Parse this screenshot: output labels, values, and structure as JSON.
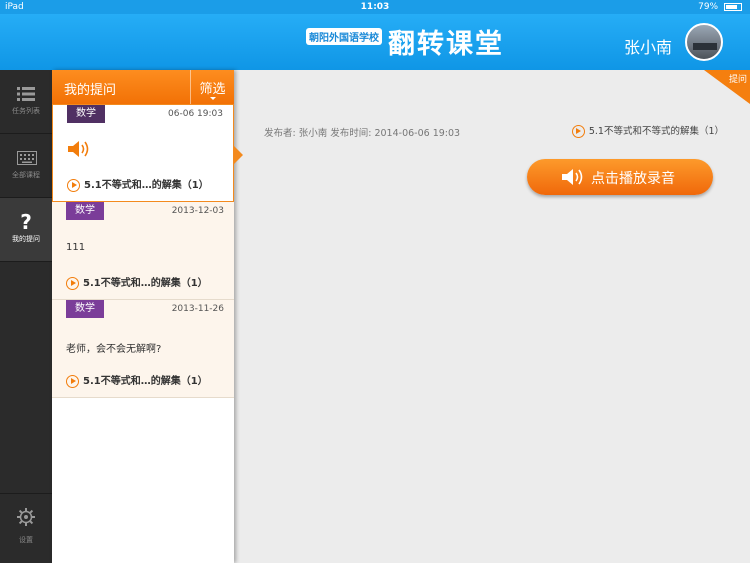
{
  "status": {
    "device": "iPad",
    "time": "11:03",
    "battery": "79%",
    "battery_level": 0.79
  },
  "header": {
    "school": "朝阳外国语学校",
    "app_title": "翻转课堂",
    "user_name": "张小南"
  },
  "nav": {
    "items": [
      {
        "label": "任务列表",
        "icon": "list-icon"
      },
      {
        "label": "全部课程",
        "icon": "keyboard-icon"
      },
      {
        "label": "我的提问",
        "icon": "question-icon"
      }
    ],
    "settings": "设置"
  },
  "list": {
    "title": "我的提问",
    "filter": "筛选",
    "items": [
      {
        "subject": "数学",
        "date": "06-06 19:03",
        "text": "",
        "has_audio": true,
        "course": "5.1不等式和…的解集（1）"
      },
      {
        "subject": "数学",
        "date": "2013-12-03",
        "text": "111",
        "has_audio": false,
        "course": "5.1不等式和…的解集（1）"
      },
      {
        "subject": "数学",
        "date": "2013-11-26",
        "text": "老师，会不会无解啊?",
        "has_audio": false,
        "course": "5.1不等式和…的解集（1）"
      }
    ]
  },
  "detail": {
    "corner_label": "提问",
    "meta": "发布者: 张小南   发布时间: 2014-06-06 19:03",
    "course": "5.1不等式和不等式的解集（1）",
    "play_label": "点击播放录音"
  },
  "colors": {
    "header_blue": "#1b9de8",
    "accent_orange": "#f27d0c",
    "tag_purple": "#7b3d99"
  }
}
